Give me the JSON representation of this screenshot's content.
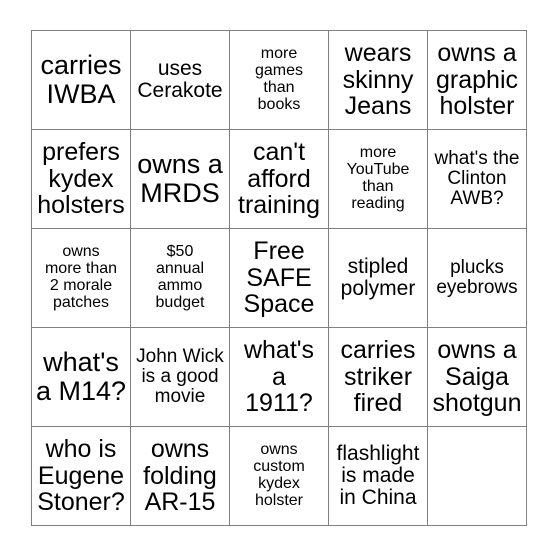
{
  "card": {
    "columns": 5,
    "rows": 5,
    "border_color": "#808080",
    "background_color": "#ffffff",
    "text_color": "#000000",
    "free_space_label": "Free\nSAFE\nSpace",
    "cells": [
      [
        {
          "text": "carries\nIWBA",
          "size": "xl"
        },
        {
          "text": "uses\nCerakote",
          "size": "md"
        },
        {
          "text": "more\ngames\nthan\nbooks",
          "size": "xs"
        },
        {
          "text": "wears\nskinny\nJeans",
          "size": "lg"
        },
        {
          "text": "owns a\ngraphic\nholster",
          "size": "lg"
        }
      ],
      [
        {
          "text": "prefers\nkydex\nholsters",
          "size": "lg"
        },
        {
          "text": "owns a\nMRDS",
          "size": "xl"
        },
        {
          "text": "can't\nafford\ntraining",
          "size": "lg"
        },
        {
          "text": "more\nYouTube\nthan\nreading",
          "size": "xs"
        },
        {
          "text": "what's the\nClinton\nAWB?",
          "size": "sm"
        }
      ],
      [
        {
          "text": "owns\nmore than\n2 morale\npatches",
          "size": "xs"
        },
        {
          "text": "$50\nannual\nammo\nbudget",
          "size": "xs"
        },
        {
          "text": "Free\nSAFE\nSpace",
          "size": "lg"
        },
        {
          "text": "stipled\npolymer",
          "size": "md"
        },
        {
          "text": "plucks\neyebrows",
          "size": "sm"
        }
      ],
      [
        {
          "text": "what's\na M14?",
          "size": "xl"
        },
        {
          "text": "John Wick\nis a good\nmovie",
          "size": "sm"
        },
        {
          "text": "what's\na\n1911?",
          "size": "lg"
        },
        {
          "text": "carries\nstriker\nfired",
          "size": "lg"
        },
        {
          "text": "owns a\nSaiga\nshotgun",
          "size": "lg"
        }
      ],
      [
        {
          "text": "who is\nEugene\nStoner?",
          "size": "lg"
        },
        {
          "text": "owns\nfolding\nAR-15",
          "size": "lg"
        },
        {
          "text": "owns\ncustom\nkydex\nholster",
          "size": "xs"
        },
        {
          "text": "flashlight\nis made\nin China",
          "size": "md"
        },
        {
          "text": "",
          "size": "xs"
        }
      ]
    ]
  }
}
